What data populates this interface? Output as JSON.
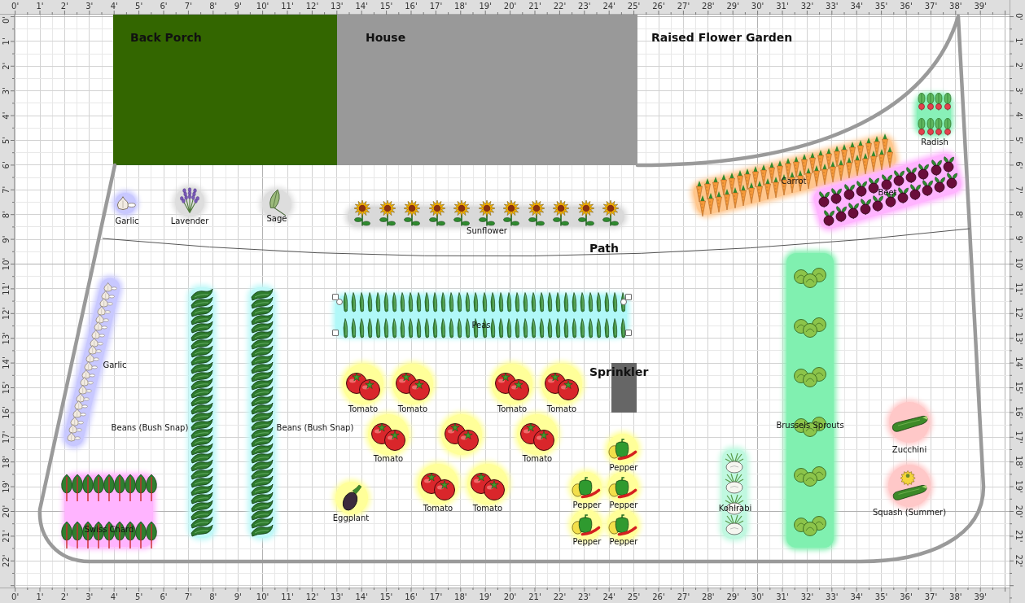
{
  "rulers": {
    "top": [
      "0'",
      "1'",
      "2'",
      "3'",
      "4'",
      "5'",
      "6'",
      "7'",
      "8'",
      "9'",
      "10'",
      "11'",
      "12'",
      "13'",
      "14'",
      "15'",
      "16'",
      "17'",
      "18'",
      "19'",
      "20'",
      "21'",
      "22'",
      "23'",
      "24'",
      "25'",
      "26'",
      "27'",
      "28'",
      "29'",
      "30'",
      "31'",
      "32'",
      "33'",
      "34'",
      "35'",
      "36'",
      "37'",
      "38'",
      "39'"
    ],
    "left": [
      "0'",
      "1'",
      "2'",
      "3'",
      "4'",
      "5'",
      "6'",
      "7'",
      "8'",
      "9'",
      "10'",
      "11'",
      "12'",
      "13'",
      "14'",
      "15'",
      "16'",
      "17'",
      "18'",
      "19'",
      "20'",
      "21'",
      "22'"
    ],
    "right": [
      "0'",
      "1'",
      "2'",
      "3'",
      "4'",
      "5'",
      "6'",
      "7'",
      "8'",
      "9'",
      "10'",
      "11'",
      "12'",
      "13'",
      "14'",
      "15'",
      "16'",
      "17'",
      "18'",
      "19'",
      "20'",
      "21'",
      "22'"
    ],
    "bottom": [
      "0'",
      "1'",
      "2'",
      "3'",
      "4'",
      "5'",
      "6'",
      "7'",
      "8'",
      "9'",
      "10'",
      "11'",
      "12'",
      "13'",
      "14'",
      "15'",
      "16'",
      "17'",
      "18'",
      "19'",
      "20'",
      "21'",
      "22'",
      "23'",
      "24'",
      "25'",
      "26'",
      "27'",
      "28'",
      "29'",
      "30'",
      "31'",
      "32'",
      "33'",
      "34'",
      "35'",
      "36'",
      "37'",
      "38'",
      "39'"
    ]
  },
  "areas": [
    {
      "kind": "porch",
      "label": "Back Porch",
      "color": "#336600"
    },
    {
      "kind": "house",
      "label": "House",
      "color": "#999999"
    },
    {
      "kind": "bed",
      "label": "Raised Flower Garden"
    },
    {
      "kind": "path",
      "label": "Path"
    },
    {
      "kind": "sprinkler",
      "label": "Sprinkler",
      "color": "#666666"
    }
  ],
  "plants": [
    {
      "name": "Garlic",
      "kind": "garlic",
      "color": "#c8c8ff",
      "selected": false
    },
    {
      "name": "Lavender",
      "kind": "lavender",
      "color": "#dddddd",
      "selected": false
    },
    {
      "name": "Sage",
      "kind": "sage",
      "color": "#dddddd",
      "selected": false
    },
    {
      "name": "Sunflower",
      "kind": "sunflower",
      "color": "#d9d9d9",
      "selected": false
    },
    {
      "name": "Carrot",
      "kind": "carrot",
      "color": "#ffc68c",
      "selected": false
    },
    {
      "name": "Beet",
      "kind": "beet",
      "color": "#ffb4ff",
      "selected": false
    },
    {
      "name": "Radish",
      "kind": "radish",
      "color": "#88f0b8",
      "selected": false
    },
    {
      "name": "Garlic",
      "kind": "garlic",
      "color": "#c8c8ff",
      "selected": false
    },
    {
      "name": "Beans (Bush Snap)",
      "kind": "bean",
      "color": "#c0f8f8",
      "selected": false
    },
    {
      "name": "Beans (Bush Snap)",
      "kind": "bean",
      "color": "#c0f8f8",
      "selected": false
    },
    {
      "name": "Peas",
      "kind": "pea",
      "color": "#b0f8f8",
      "selected": true
    },
    {
      "name": "Brussels Sprouts",
      "kind": "sprout",
      "color": "#80f0b0",
      "selected": false
    },
    {
      "name": "Tomato",
      "kind": "tomato",
      "color": "#ffff99",
      "selected": false
    },
    {
      "name": "Tomato",
      "kind": "tomato",
      "color": "#ffff99",
      "selected": false
    },
    {
      "name": "Tomato",
      "kind": "tomato",
      "color": "#ffff99",
      "selected": false
    },
    {
      "name": "Tomato",
      "kind": "tomato",
      "color": "#ffff99",
      "selected": false
    },
    {
      "name": "Zucchini",
      "kind": "zucchini",
      "color": "#ffc8c8",
      "selected": false
    },
    {
      "name": "Tomato",
      "kind": "tomato",
      "color": "#ffff99",
      "selected": false
    },
    {
      "kind": "tomato",
      "color": "#ffff99",
      "selected": false
    },
    {
      "name": "Tomato",
      "kind": "tomato",
      "color": "#ffff99",
      "selected": false
    },
    {
      "name": "Pepper",
      "kind": "pepper",
      "color": "#ffff99",
      "selected": false
    },
    {
      "name": "Kohlrabi",
      "kind": "kohlrabi",
      "color": "#c0f8e0",
      "selected": false
    },
    {
      "name": "Swiss Chard",
      "kind": "chard",
      "color": "#ffb4ff",
      "selected": false
    },
    {
      "name": "Tomato",
      "kind": "tomato",
      "color": "#ffff99",
      "selected": false
    },
    {
      "name": "Tomato",
      "kind": "tomato",
      "color": "#ffff99",
      "selected": false
    },
    {
      "name": "Pepper",
      "kind": "pepper",
      "color": "#ffff99",
      "selected": false
    },
    {
      "name": "Pepper",
      "kind": "pepper",
      "color": "#ffff99",
      "selected": false
    },
    {
      "name": "Squash (Summer)",
      "kind": "squash",
      "color": "#ffc8c8",
      "selected": false
    },
    {
      "name": "Eggplant",
      "kind": "eggplant",
      "color": "#ffff99",
      "selected": false
    },
    {
      "name": "Pepper",
      "kind": "pepper",
      "color": "#ffff99",
      "selected": false
    },
    {
      "name": "Pepper",
      "kind": "pepper",
      "color": "#ffff99",
      "selected": false
    }
  ]
}
